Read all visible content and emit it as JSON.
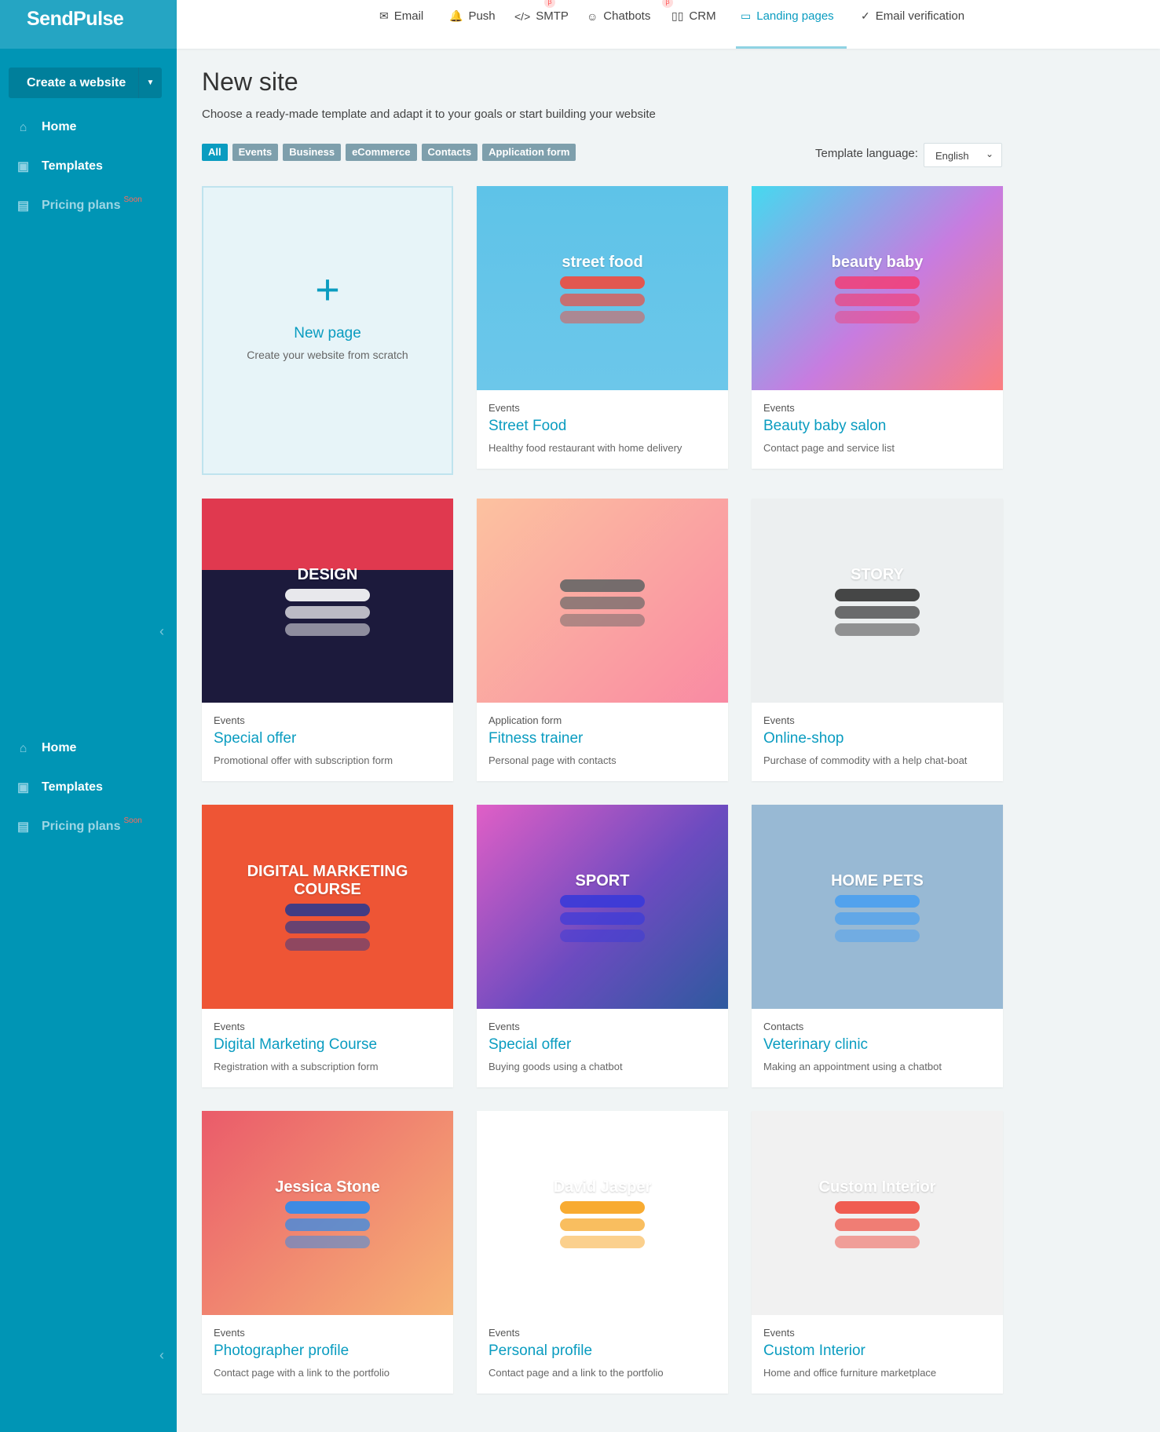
{
  "brand": "SendPulse",
  "sidebar": {
    "create_label": "Create a website",
    "items": [
      {
        "label": "Home",
        "icon": "home-icon"
      },
      {
        "label": "Templates",
        "icon": "templates-icon"
      },
      {
        "label": "Pricing plans",
        "icon": "wallet-icon",
        "badge": "Soon"
      }
    ],
    "items2": [
      {
        "label": "Home",
        "icon": "home-icon"
      },
      {
        "label": "Templates",
        "icon": "templates-icon"
      },
      {
        "label": "Pricing plans",
        "icon": "wallet-icon",
        "badge": "Soon"
      }
    ]
  },
  "topnav": [
    {
      "label": "Email",
      "icon": "✉"
    },
    {
      "label": "Push",
      "icon": "🔔"
    },
    {
      "label": "SMTP",
      "icon": "</>"
    },
    {
      "label": "Chatbots",
      "icon": "☺"
    },
    {
      "label": "CRM",
      "icon": "▯▯"
    },
    {
      "label": "Landing pages",
      "icon": "▭",
      "active": true
    },
    {
      "label": "Email verification",
      "icon": "✓"
    }
  ],
  "beta": "β",
  "page": {
    "title": "New site",
    "subtitle": "Choose a ready-made template and adapt it to your goals or start building your website"
  },
  "filters": [
    "All",
    "Events",
    "Business",
    "eCommerce",
    "Contacts",
    "Application form"
  ],
  "language": {
    "label": "Template language:",
    "value": "English"
  },
  "new_page": {
    "title": "New page",
    "desc": "Create your website from scratch"
  },
  "accent": "#0a9cc0",
  "templates": [
    {
      "cat": "Events",
      "title": "Street Food",
      "desc": "Healthy food restaurant with home delivery",
      "preview": "street food",
      "bg": "linear-gradient(#5ec3e8,#6cc7ea)",
      "pill": "#f04a3e"
    },
    {
      "cat": "Events",
      "title": "Beauty baby salon",
      "desc": "Contact page and service list",
      "preview": "beauty baby",
      "bg": "linear-gradient(135deg,#45d9ef,#c77ce0 55%,#fb7e80)",
      "pill": "#f0417b"
    },
    {
      "cat": "Events",
      "title": "Special offer",
      "desc": "Promotional offer with subscription form",
      "preview": "DESIGN",
      "bg": "linear-gradient(#e0394f 35%,#1c1a3c 35%)",
      "pill": "#ffffff"
    },
    {
      "cat": "Application form",
      "title": "Fitness trainer",
      "desc": "Personal page with contacts",
      "preview": "",
      "bg": "linear-gradient(135deg,#fcc2a0,#f98aa3)",
      "pill": "#666666"
    },
    {
      "cat": "Events",
      "title": "Online-shop",
      "desc": "Purchase of commodity with a help chat-boat",
      "preview": "STORY",
      "bg": "#eceff0",
      "pill": "#333333"
    },
    {
      "cat": "Events",
      "title": "Digital Marketing Course",
      "desc": "Registration with a subscription form",
      "preview": "DIGITAL MARKETING COURSE",
      "bg": "#ee5535",
      "pill": "#2f3a8c"
    },
    {
      "cat": "Events",
      "title": "Special offer",
      "desc": "Buying goods using a chatbot",
      "preview": "SPORT",
      "bg": "linear-gradient(135deg,#e05fc6,#6c4bc0 55%,#2e5a9e)",
      "pill": "#3a3ad8"
    },
    {
      "cat": "Contacts",
      "title": "Veterinary clinic",
      "desc": "Making an appointment using a chatbot",
      "preview": "HOME PETS",
      "bg": "#98b9d4",
      "pill": "#4aa0f0"
    },
    {
      "cat": "Events",
      "title": "Photographer profile",
      "desc": "Contact page with a link to the portfolio",
      "preview": "Jessica Stone",
      "bg": "linear-gradient(135deg,#ea5b6a,#f7b476)",
      "pill": "#2a8cf0"
    },
    {
      "cat": "Events",
      "title": "Personal profile",
      "desc": "Contact page and a link to the portfolio",
      "preview": "David Jasper",
      "bg": "#ffffff",
      "pill": "#f7a21b"
    },
    {
      "cat": "Events",
      "title": "Custom Interior",
      "desc": "Home and office furniture marketplace",
      "preview": "Custom Interior",
      "bg": "#f1f1f1",
      "pill": "#ef4b3f"
    }
  ]
}
